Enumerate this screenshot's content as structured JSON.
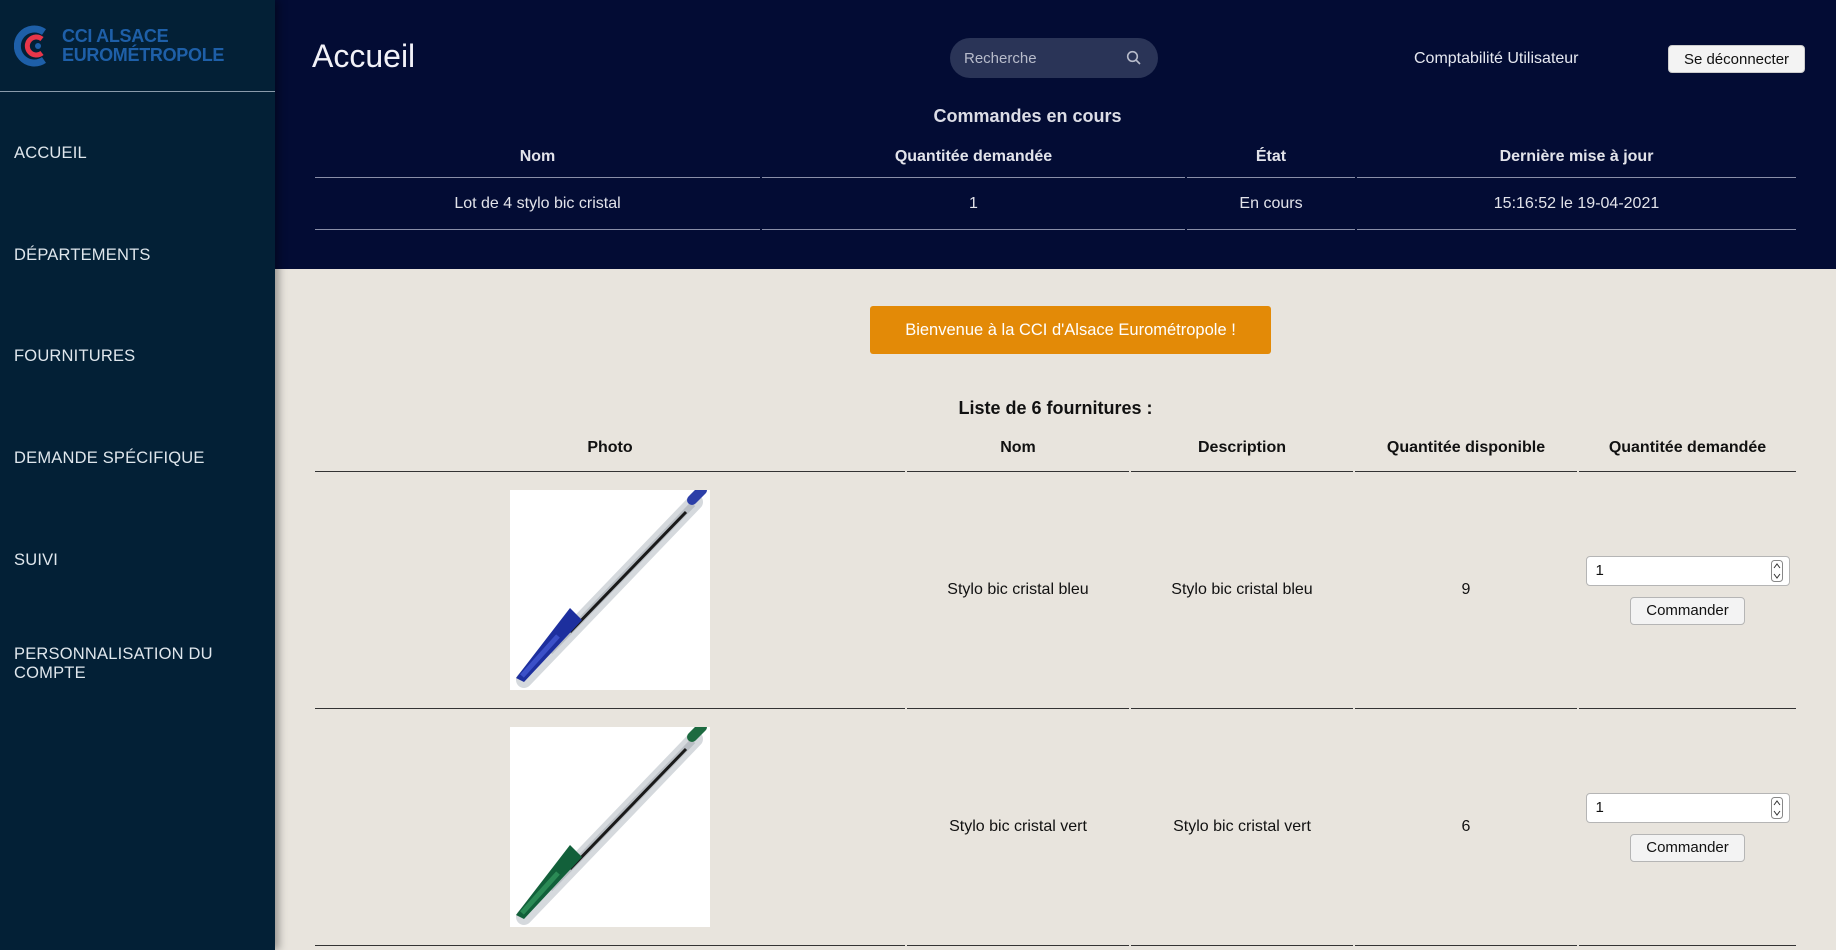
{
  "brand": {
    "line1": "CCI ALSACE",
    "line2": "EUROMÉTROPOLE",
    "accent": "#1e5fa8",
    "mark_color": "#e8364a"
  },
  "sidebar": {
    "items": [
      {
        "label": "ACCUEIL"
      },
      {
        "label": "DÉPARTEMENTS"
      },
      {
        "label": "FOURNITURES"
      },
      {
        "label": "DEMANDE SPÉCIFIQUE"
      },
      {
        "label": "SUIVI"
      },
      {
        "label": "PERSONNALISATION DU COMPTE"
      }
    ]
  },
  "header": {
    "title": "Accueil",
    "search_placeholder": "Recherche",
    "search_icon": "search-icon",
    "user": "Comptabilité Utilisateur",
    "logout_label": "Se déconnecter"
  },
  "orders": {
    "title": "Commandes en cours",
    "columns": [
      "Nom",
      "Quantitée demandée",
      "État",
      "Dernière mise à jour"
    ],
    "rows": [
      [
        "Lot de 4 stylo bic cristal",
        "1",
        "En cours",
        "15:16:52 le 19-04-2021"
      ]
    ]
  },
  "welcome_label": "Bienvenue à la CCI d'Alsace Eurométropole !",
  "supplies": {
    "title": "Liste de 6 fournitures :",
    "columns": [
      "Photo",
      "Nom",
      "Description",
      "Quantitée disponible",
      "Quantitée demandée"
    ],
    "rows": [
      {
        "name": "Stylo bic cristal bleu",
        "description": "Stylo bic cristal bleu",
        "available": "9",
        "requested": "1",
        "order_label": "Commander",
        "pen_color": "#1d2f9e",
        "pen_icon": "blue-pen-image"
      },
      {
        "name": "Stylo bic cristal vert",
        "description": "Stylo bic cristal vert",
        "available": "6",
        "requested": "1",
        "order_label": "Commander",
        "pen_color": "#12603a",
        "pen_icon": "green-pen-image"
      }
    ]
  },
  "colors": {
    "sidebar_bg": "#032036",
    "topbar_bg": "#030c34",
    "main_bg": "#e8e4dd",
    "welcome_bg": "#e38a07"
  }
}
